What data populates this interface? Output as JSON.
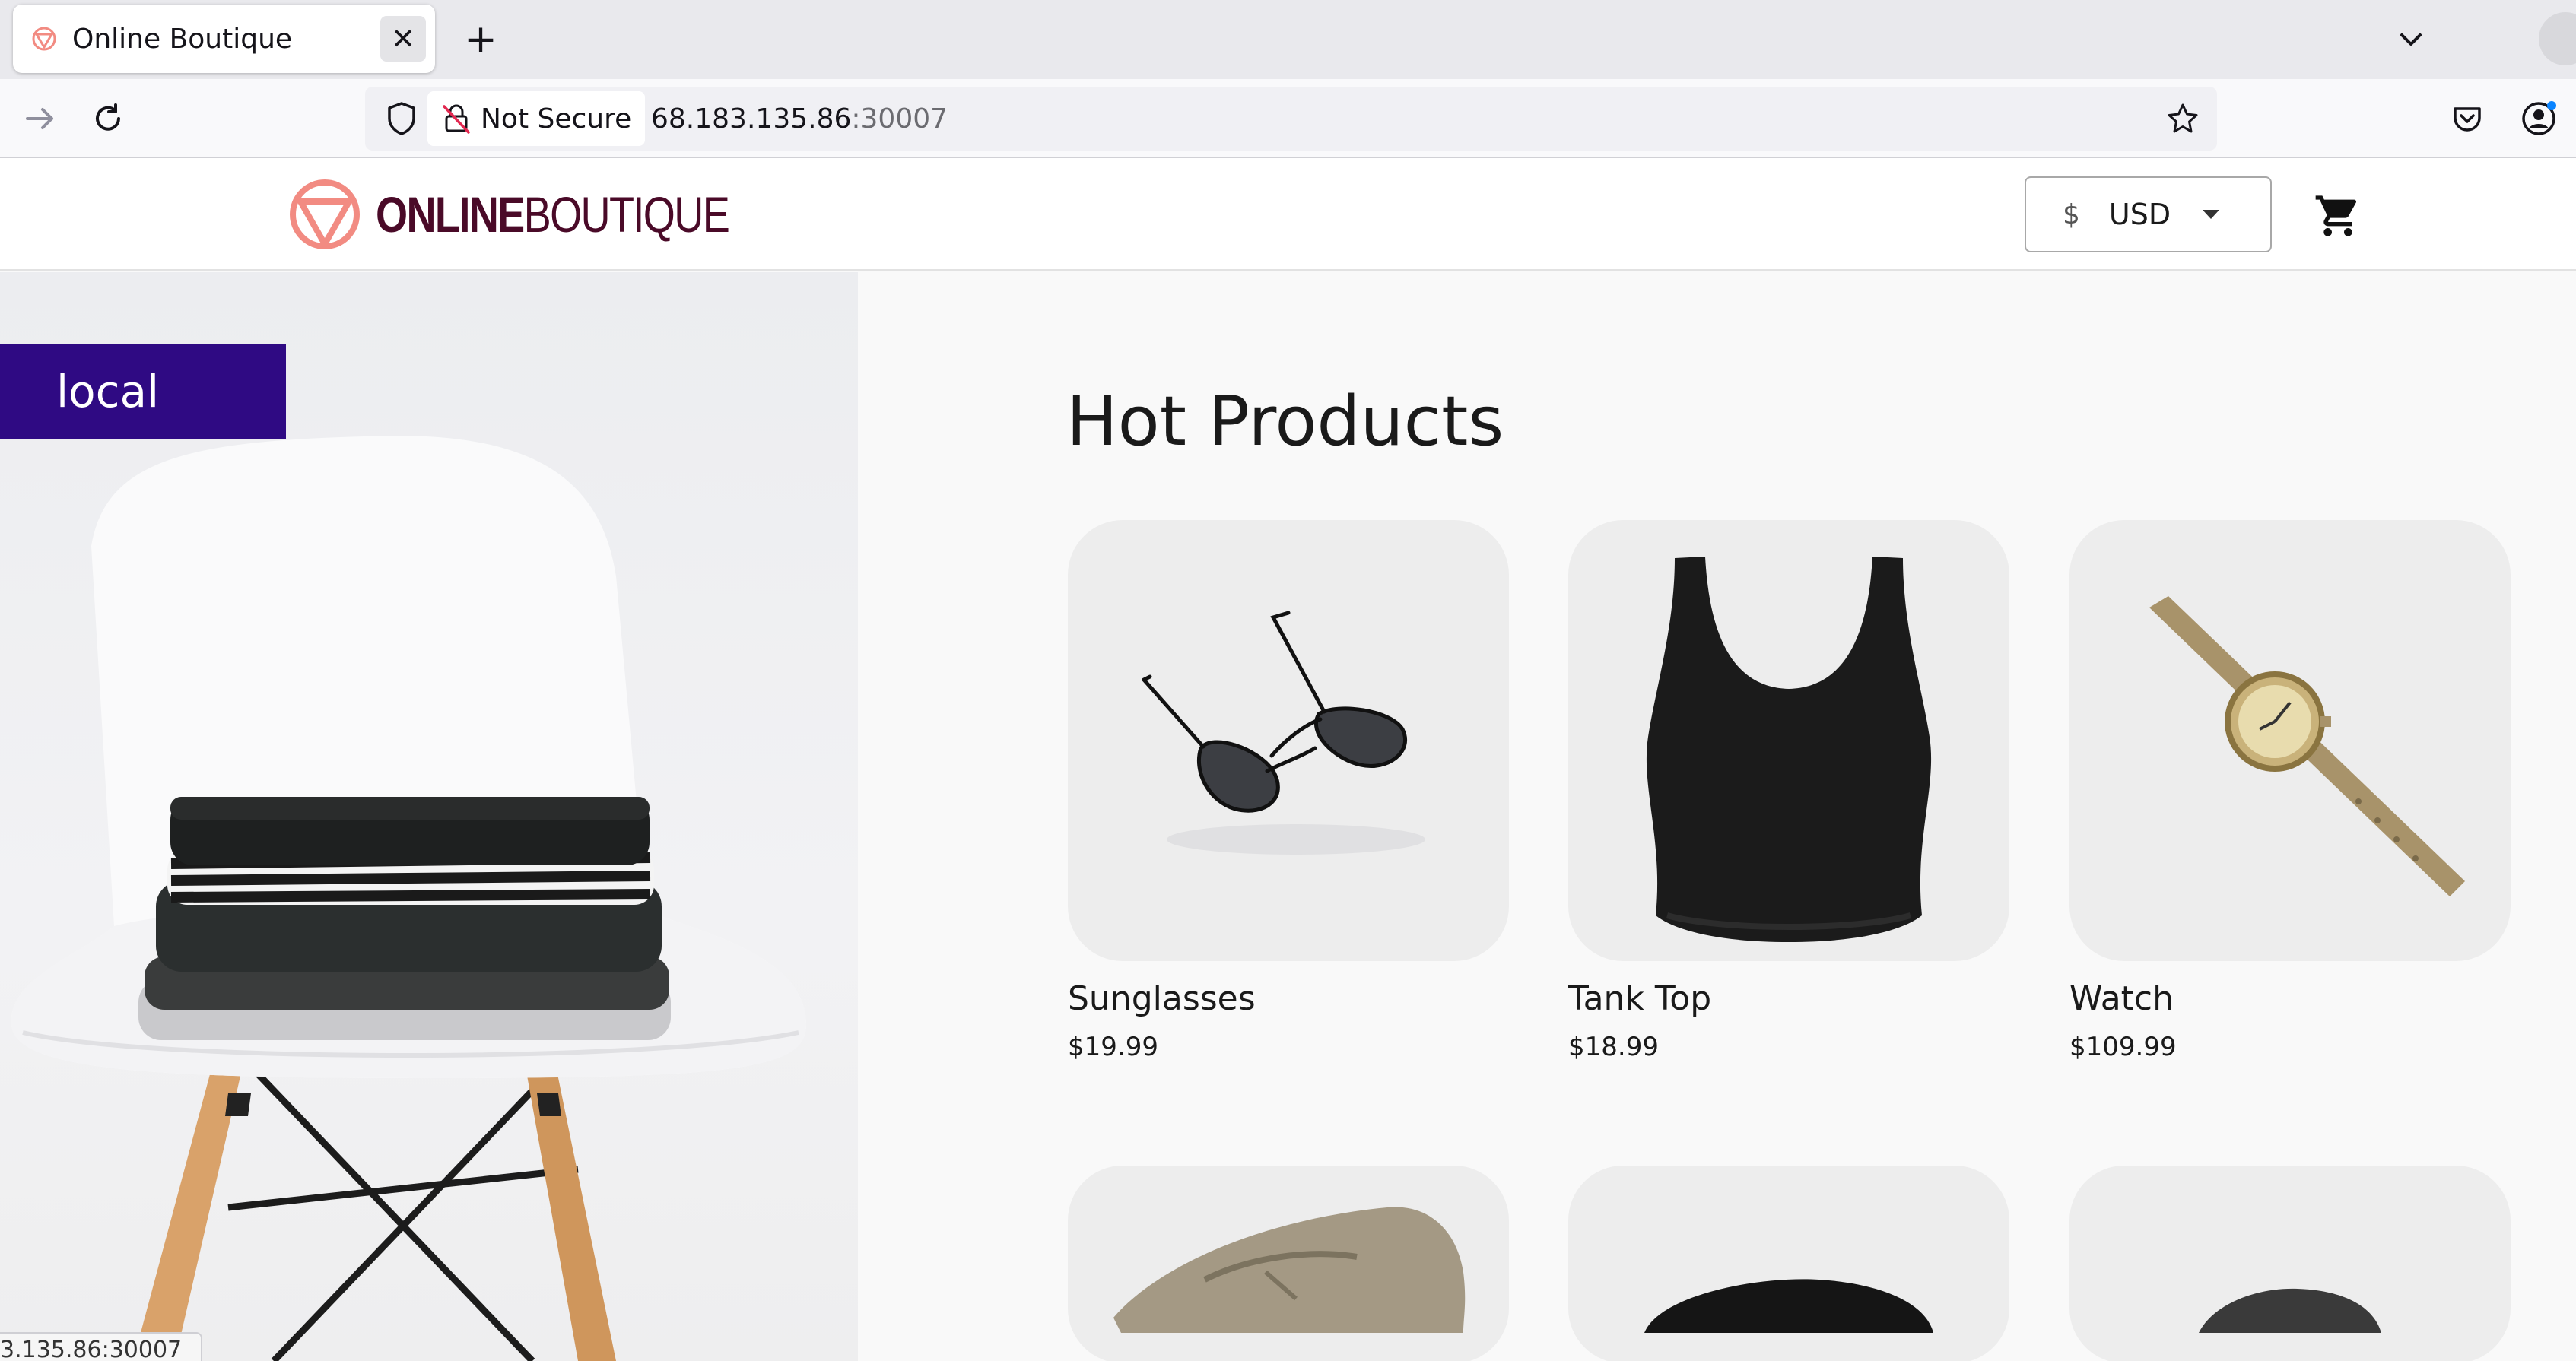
{
  "browser": {
    "tab_title": "Online Boutique",
    "close_glyph": "✕",
    "newtab_glyph": "+",
    "security_label": "Not Secure",
    "url_host": "68.183.135.86",
    "url_port": ":30007",
    "status_url": "3.135.86:30007"
  },
  "header": {
    "logo_bold": "ONLINE",
    "logo_light": "BOUTIQUE",
    "currency_symbol": "$",
    "currency_code": "USD"
  },
  "hero": {
    "badge": "local"
  },
  "main": {
    "title": "Hot Products",
    "products": [
      {
        "name": "Sunglasses",
        "price": "$19.99"
      },
      {
        "name": "Tank Top",
        "price": "$18.99"
      },
      {
        "name": "Watch",
        "price": "$109.99"
      }
    ]
  },
  "colors": {
    "brand": "#4a0a28",
    "logo_accent": "#f28b82",
    "badge_bg": "#2f0a83"
  },
  "icons": [
    "forward-icon",
    "reload-icon",
    "shield-icon",
    "insecure-lock-icon",
    "bookmark-star-icon",
    "pocket-icon",
    "account-icon",
    "cart-icon",
    "tab-list-icon"
  ]
}
